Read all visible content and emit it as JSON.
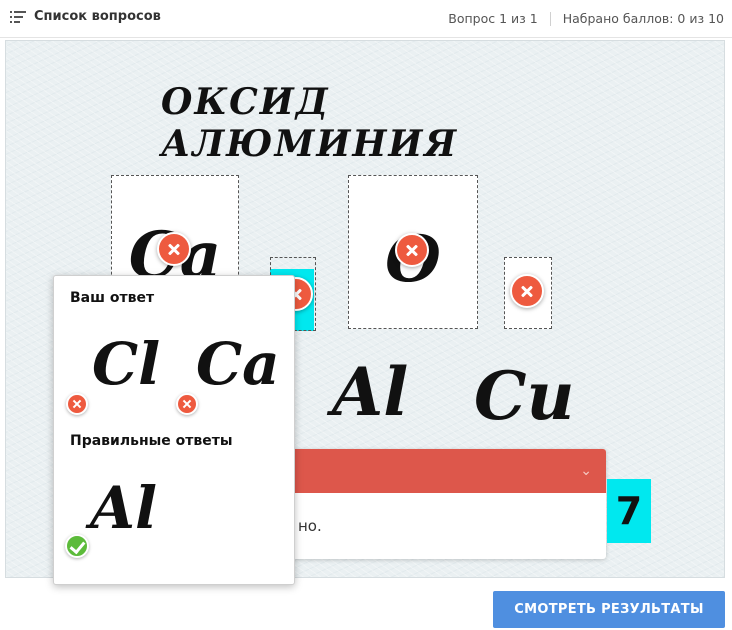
{
  "header": {
    "question_list_label": "Список вопросов",
    "question_counter": "Вопрос 1 из 1",
    "score_text": "Набрано баллов: 0 из 10"
  },
  "slide": {
    "title": "ОКСИД АЛЮМИНИЯ",
    "drop_zones": [
      {
        "symbol": "Ca",
        "status": "incorrect"
      },
      {
        "symbol": "",
        "status": "incorrect"
      },
      {
        "symbol": "O",
        "status": "incorrect"
      },
      {
        "symbol": "",
        "status": "incorrect"
      }
    ],
    "answer_options": [
      "Al",
      "Cu"
    ],
    "number_badge": "7"
  },
  "feedback": {
    "visible_text": "но."
  },
  "popup": {
    "your_answer_heading": "Ваш ответ",
    "your_answers": [
      "Cl",
      "Ca"
    ],
    "correct_heading": "Правильные ответы",
    "correct_answers": [
      "Al"
    ]
  },
  "footer": {
    "results_button_label": "СМОТРЕТЬ РЕЗУЛЬТАТЫ"
  },
  "colors": {
    "incorrect": "#ee5a3f",
    "correct": "#5cbb3a",
    "feedback_header": "#dd574b",
    "button": "#4f8fe0",
    "highlight": "#00e8ef"
  }
}
